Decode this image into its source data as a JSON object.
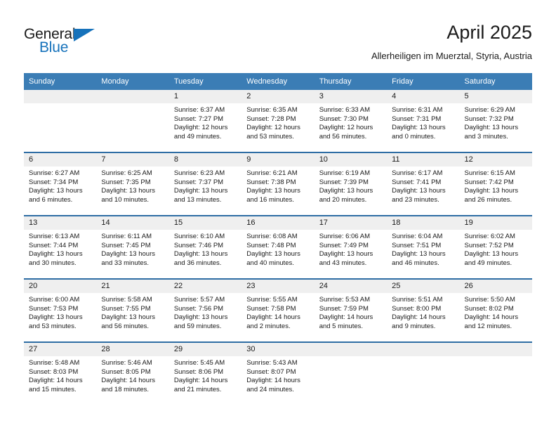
{
  "brand": {
    "name_part1": "General",
    "name_part2": "Blue",
    "logo_icon": "triangle-icon",
    "colors": {
      "blue": "#1672bb",
      "dark": "#1a1a1a"
    }
  },
  "header": {
    "title": "April 2025",
    "subtitle": "Allerheiligen im Muerztal, Styria, Austria"
  },
  "theme": {
    "header_bar": "#3b7db5",
    "row_divider": "#2e6da4",
    "daynum_band": "#efefef"
  },
  "weekday_headers": [
    "Sunday",
    "Monday",
    "Tuesday",
    "Wednesday",
    "Thursday",
    "Friday",
    "Saturday"
  ],
  "labels": {
    "sunrise_prefix": "Sunrise:",
    "sunset_prefix": "Sunset:",
    "daylight_prefix": "Daylight:"
  },
  "weeks": [
    [
      {
        "day": "",
        "sunrise": "",
        "sunset": "",
        "daylight_line1": "",
        "daylight_line2": "",
        "empty": true
      },
      {
        "day": "",
        "sunrise": "",
        "sunset": "",
        "daylight_line1": "",
        "daylight_line2": "",
        "empty": true
      },
      {
        "day": "1",
        "sunrise": "Sunrise: 6:37 AM",
        "sunset": "Sunset: 7:27 PM",
        "daylight_line1": "Daylight: 12 hours",
        "daylight_line2": "and 49 minutes.",
        "empty": false
      },
      {
        "day": "2",
        "sunrise": "Sunrise: 6:35 AM",
        "sunset": "Sunset: 7:28 PM",
        "daylight_line1": "Daylight: 12 hours",
        "daylight_line2": "and 53 minutes.",
        "empty": false
      },
      {
        "day": "3",
        "sunrise": "Sunrise: 6:33 AM",
        "sunset": "Sunset: 7:30 PM",
        "daylight_line1": "Daylight: 12 hours",
        "daylight_line2": "and 56 minutes.",
        "empty": false
      },
      {
        "day": "4",
        "sunrise": "Sunrise: 6:31 AM",
        "sunset": "Sunset: 7:31 PM",
        "daylight_line1": "Daylight: 13 hours",
        "daylight_line2": "and 0 minutes.",
        "empty": false
      },
      {
        "day": "5",
        "sunrise": "Sunrise: 6:29 AM",
        "sunset": "Sunset: 7:32 PM",
        "daylight_line1": "Daylight: 13 hours",
        "daylight_line2": "and 3 minutes.",
        "empty": false
      }
    ],
    [
      {
        "day": "6",
        "sunrise": "Sunrise: 6:27 AM",
        "sunset": "Sunset: 7:34 PM",
        "daylight_line1": "Daylight: 13 hours",
        "daylight_line2": "and 6 minutes.",
        "empty": false
      },
      {
        "day": "7",
        "sunrise": "Sunrise: 6:25 AM",
        "sunset": "Sunset: 7:35 PM",
        "daylight_line1": "Daylight: 13 hours",
        "daylight_line2": "and 10 minutes.",
        "empty": false
      },
      {
        "day": "8",
        "sunrise": "Sunrise: 6:23 AM",
        "sunset": "Sunset: 7:37 PM",
        "daylight_line1": "Daylight: 13 hours",
        "daylight_line2": "and 13 minutes.",
        "empty": false
      },
      {
        "day": "9",
        "sunrise": "Sunrise: 6:21 AM",
        "sunset": "Sunset: 7:38 PM",
        "daylight_line1": "Daylight: 13 hours",
        "daylight_line2": "and 16 minutes.",
        "empty": false
      },
      {
        "day": "10",
        "sunrise": "Sunrise: 6:19 AM",
        "sunset": "Sunset: 7:39 PM",
        "daylight_line1": "Daylight: 13 hours",
        "daylight_line2": "and 20 minutes.",
        "empty": false
      },
      {
        "day": "11",
        "sunrise": "Sunrise: 6:17 AM",
        "sunset": "Sunset: 7:41 PM",
        "daylight_line1": "Daylight: 13 hours",
        "daylight_line2": "and 23 minutes.",
        "empty": false
      },
      {
        "day": "12",
        "sunrise": "Sunrise: 6:15 AM",
        "sunset": "Sunset: 7:42 PM",
        "daylight_line1": "Daylight: 13 hours",
        "daylight_line2": "and 26 minutes.",
        "empty": false
      }
    ],
    [
      {
        "day": "13",
        "sunrise": "Sunrise: 6:13 AM",
        "sunset": "Sunset: 7:44 PM",
        "daylight_line1": "Daylight: 13 hours",
        "daylight_line2": "and 30 minutes.",
        "empty": false
      },
      {
        "day": "14",
        "sunrise": "Sunrise: 6:11 AM",
        "sunset": "Sunset: 7:45 PM",
        "daylight_line1": "Daylight: 13 hours",
        "daylight_line2": "and 33 minutes.",
        "empty": false
      },
      {
        "day": "15",
        "sunrise": "Sunrise: 6:10 AM",
        "sunset": "Sunset: 7:46 PM",
        "daylight_line1": "Daylight: 13 hours",
        "daylight_line2": "and 36 minutes.",
        "empty": false
      },
      {
        "day": "16",
        "sunrise": "Sunrise: 6:08 AM",
        "sunset": "Sunset: 7:48 PM",
        "daylight_line1": "Daylight: 13 hours",
        "daylight_line2": "and 40 minutes.",
        "empty": false
      },
      {
        "day": "17",
        "sunrise": "Sunrise: 6:06 AM",
        "sunset": "Sunset: 7:49 PM",
        "daylight_line1": "Daylight: 13 hours",
        "daylight_line2": "and 43 minutes.",
        "empty": false
      },
      {
        "day": "18",
        "sunrise": "Sunrise: 6:04 AM",
        "sunset": "Sunset: 7:51 PM",
        "daylight_line1": "Daylight: 13 hours",
        "daylight_line2": "and 46 minutes.",
        "empty": false
      },
      {
        "day": "19",
        "sunrise": "Sunrise: 6:02 AM",
        "sunset": "Sunset: 7:52 PM",
        "daylight_line1": "Daylight: 13 hours",
        "daylight_line2": "and 49 minutes.",
        "empty": false
      }
    ],
    [
      {
        "day": "20",
        "sunrise": "Sunrise: 6:00 AM",
        "sunset": "Sunset: 7:53 PM",
        "daylight_line1": "Daylight: 13 hours",
        "daylight_line2": "and 53 minutes.",
        "empty": false
      },
      {
        "day": "21",
        "sunrise": "Sunrise: 5:58 AM",
        "sunset": "Sunset: 7:55 PM",
        "daylight_line1": "Daylight: 13 hours",
        "daylight_line2": "and 56 minutes.",
        "empty": false
      },
      {
        "day": "22",
        "sunrise": "Sunrise: 5:57 AM",
        "sunset": "Sunset: 7:56 PM",
        "daylight_line1": "Daylight: 13 hours",
        "daylight_line2": "and 59 minutes.",
        "empty": false
      },
      {
        "day": "23",
        "sunrise": "Sunrise: 5:55 AM",
        "sunset": "Sunset: 7:58 PM",
        "daylight_line1": "Daylight: 14 hours",
        "daylight_line2": "and 2 minutes.",
        "empty": false
      },
      {
        "day": "24",
        "sunrise": "Sunrise: 5:53 AM",
        "sunset": "Sunset: 7:59 PM",
        "daylight_line1": "Daylight: 14 hours",
        "daylight_line2": "and 5 minutes.",
        "empty": false
      },
      {
        "day": "25",
        "sunrise": "Sunrise: 5:51 AM",
        "sunset": "Sunset: 8:00 PM",
        "daylight_line1": "Daylight: 14 hours",
        "daylight_line2": "and 9 minutes.",
        "empty": false
      },
      {
        "day": "26",
        "sunrise": "Sunrise: 5:50 AM",
        "sunset": "Sunset: 8:02 PM",
        "daylight_line1": "Daylight: 14 hours",
        "daylight_line2": "and 12 minutes.",
        "empty": false
      }
    ],
    [
      {
        "day": "27",
        "sunrise": "Sunrise: 5:48 AM",
        "sunset": "Sunset: 8:03 PM",
        "daylight_line1": "Daylight: 14 hours",
        "daylight_line2": "and 15 minutes.",
        "empty": false
      },
      {
        "day": "28",
        "sunrise": "Sunrise: 5:46 AM",
        "sunset": "Sunset: 8:05 PM",
        "daylight_line1": "Daylight: 14 hours",
        "daylight_line2": "and 18 minutes.",
        "empty": false
      },
      {
        "day": "29",
        "sunrise": "Sunrise: 5:45 AM",
        "sunset": "Sunset: 8:06 PM",
        "daylight_line1": "Daylight: 14 hours",
        "daylight_line2": "and 21 minutes.",
        "empty": false
      },
      {
        "day": "30",
        "sunrise": "Sunrise: 5:43 AM",
        "sunset": "Sunset: 8:07 PM",
        "daylight_line1": "Daylight: 14 hours",
        "daylight_line2": "and 24 minutes.",
        "empty": false
      },
      {
        "day": "",
        "sunrise": "",
        "sunset": "",
        "daylight_line1": "",
        "daylight_line2": "",
        "empty": true
      },
      {
        "day": "",
        "sunrise": "",
        "sunset": "",
        "daylight_line1": "",
        "daylight_line2": "",
        "empty": true
      },
      {
        "day": "",
        "sunrise": "",
        "sunset": "",
        "daylight_line1": "",
        "daylight_line2": "",
        "empty": true
      }
    ]
  ]
}
